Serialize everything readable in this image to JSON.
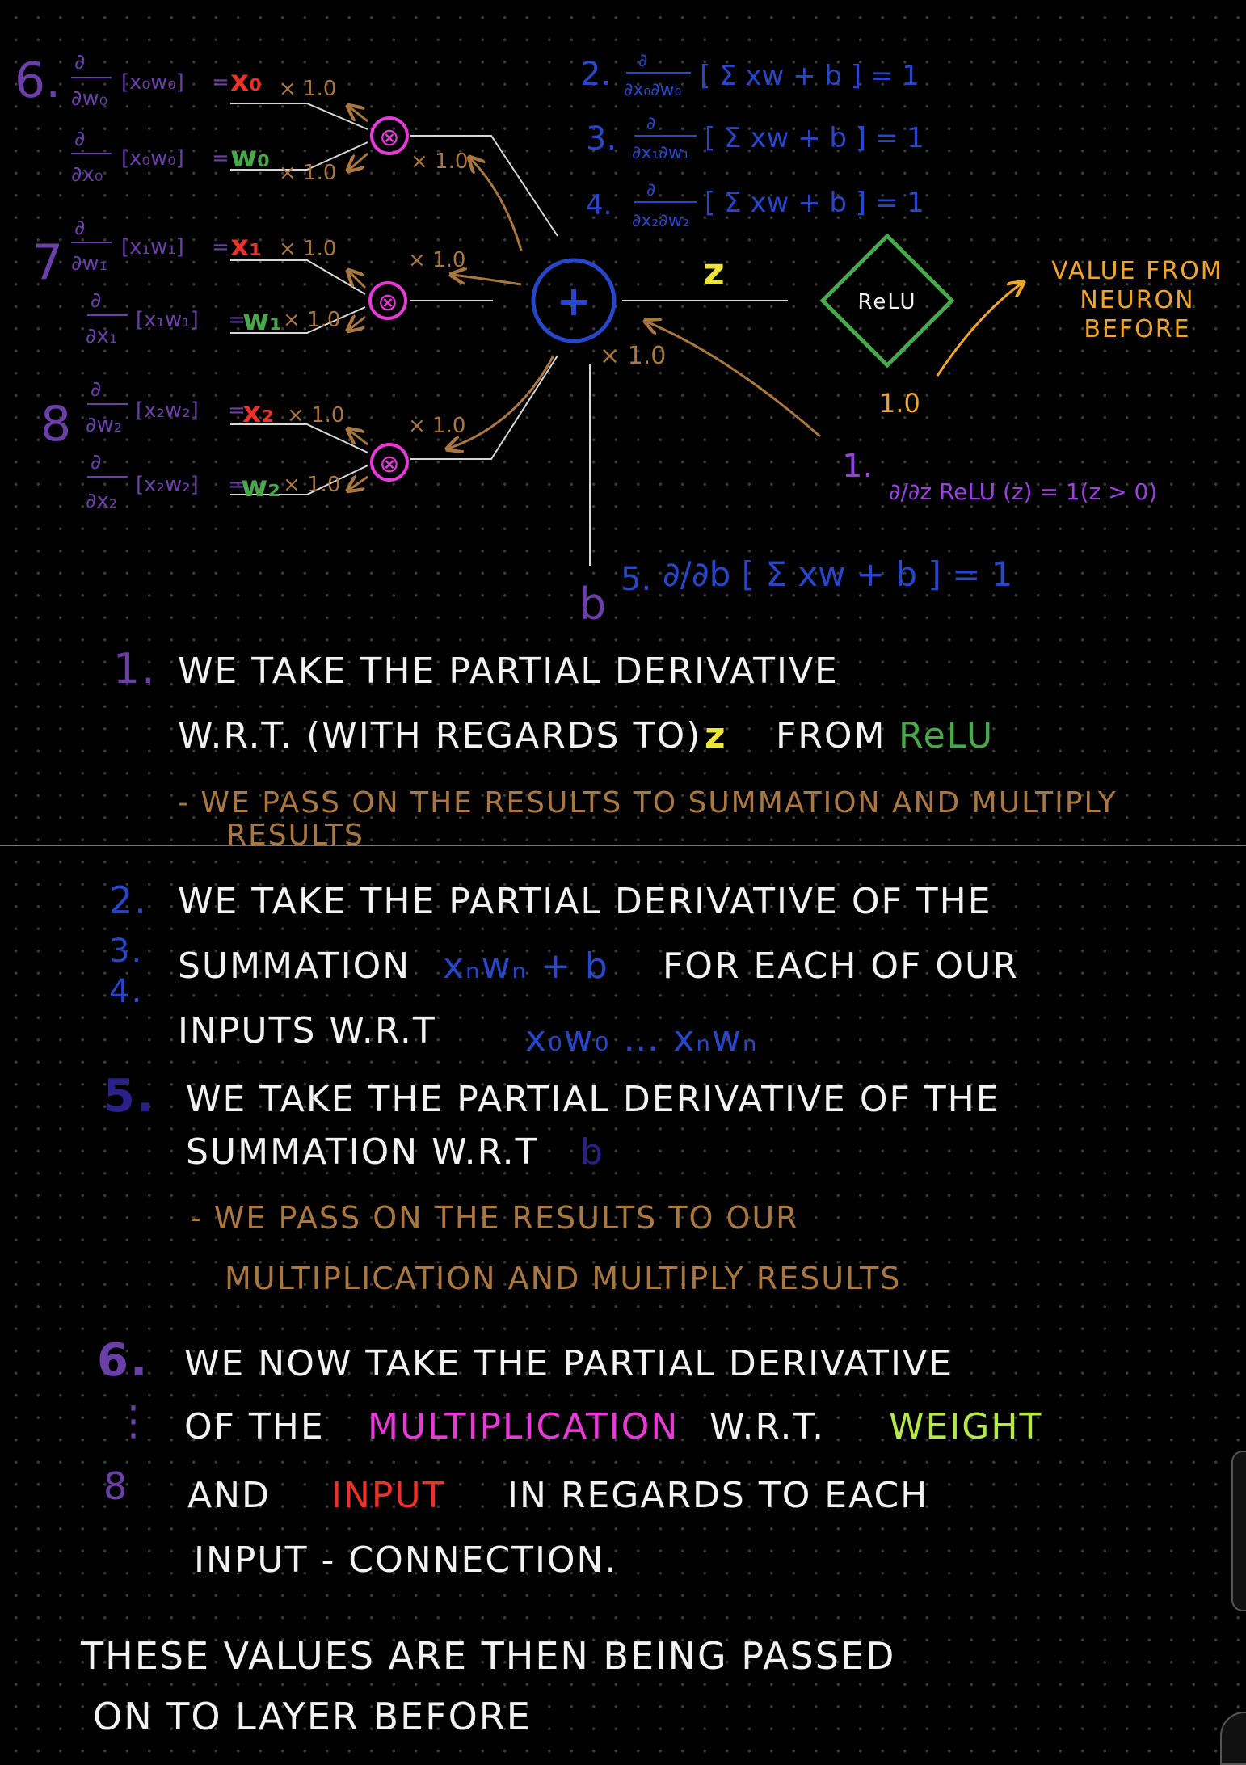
{
  "colors": {
    "purple": "#6b3fa8",
    "blue": "#2846c8",
    "pink": "#e83ad6",
    "red": "#e8322a",
    "green": "#48a84a",
    "yellow": "#ece63a",
    "brown": "#a9773f",
    "orange": "#f0a52a",
    "white": "#f2f2f2",
    "lime": "#b6e84a",
    "line": "#d8d8d8"
  },
  "diagram": {
    "left_eqs": [
      {
        "num": "6.",
        "d": "∂",
        "wrt": "∂w₀",
        "bracket": "[x₀w₀]",
        "eq": "=",
        "result": "x₀",
        "result_color": "red",
        "times": "× 1.0"
      },
      {
        "num": "",
        "d": "∂",
        "wrt": "∂x₀",
        "bracket": "[x₀w₀]",
        "eq": "=",
        "result": "w₀",
        "result_color": "green",
        "times": "× 1.0"
      },
      {
        "num": "7",
        "d": "∂",
        "wrt": "∂w₁",
        "bracket": "[x₁w₁]",
        "eq": "=",
        "result": "x₁",
        "result_color": "red",
        "times": "× 1.0"
      },
      {
        "num": "",
        "d": "∂",
        "wrt": "∂x₁",
        "bracket": "[x₁w₁]",
        "eq": "=",
        "result": "w₁",
        "result_color": "green",
        "times": "× 1.0"
      },
      {
        "num": "8",
        "d": "∂",
        "wrt": "∂w₂",
        "bracket": "[x₂w₂]",
        "eq": "=",
        "result": "x₂",
        "result_color": "red",
        "times": "× 1.0"
      },
      {
        "num": "",
        "d": "∂",
        "wrt": "∂x₂",
        "bracket": "[x₂w₂]",
        "eq": "=",
        "result": "w₂",
        "result_color": "green",
        "times": "× 1.0"
      }
    ],
    "mult_nodes": [
      "⊗",
      "⊗",
      "⊗"
    ],
    "mult_out_labels": [
      "× 1.0",
      "× 1.0",
      "× 1.0"
    ],
    "sum_node": "+",
    "sum_out_label": "× 1.0",
    "z_label": "z",
    "relu_label": "ReLU",
    "relu_grad": "1.0",
    "prev_value": "Value from neuron before",
    "top_eqs": [
      {
        "num": "2.",
        "wrt": "∂x₀∂w₀",
        "body": "[ Σ xw + b ] = 1"
      },
      {
        "num": "3.",
        "wrt": "∂x₁∂w₁",
        "body": "[ Σ xw + b ] = 1"
      },
      {
        "num": "4.",
        "wrt": "∂x₂∂w₂",
        "body": "[ Σ xw + b ] = 1"
      }
    ],
    "relu_eq_num": "1.",
    "relu_eq": "∂/∂z ReLU (z) = 1(z > 0)",
    "bias": "b",
    "bias_eq_num": "5.",
    "bias_eq": "∂/∂b [ Σ xw + b ] = 1"
  },
  "notes": {
    "n1": {
      "num": "1.",
      "line1": "WE TAKE THE PARTIAL DERIVATIVE",
      "line2_a": "W.R.T. (WITH REGARDS TO)",
      "line2_z": "z",
      "line2_b": "FROM",
      "line2_relu": "ReLU",
      "sub1": "- WE PASS ON THE RESULTS TO SUMMATION AND MULTIPLY",
      "sub2": "RESULTS"
    },
    "n2": {
      "nums": [
        "2.",
        "3.",
        "4."
      ],
      "line1": "WE TAKE THE PARTIAL DERIVATIVE  OF THE",
      "line2_a": "SUMMATION",
      "line2_expr": "xₙwₙ + b",
      "line2_b": "FOR EACH  OF OUR",
      "line3_a": "INPUTS   W.R.T",
      "line3_expr": "x₀w₀ … xₙwₙ"
    },
    "n5": {
      "num": "5.",
      "line1": "WE TAKE THE PARTIAL DERIVATIVE OF THE",
      "line2_a": "SUMMATION W.R.T",
      "line2_b": "b",
      "sub1": "- WE PASS ON THE RESULTS TO OUR",
      "sub2": "MULTIPLICATION AND MULTIPLY RESULTS"
    },
    "n6": {
      "num": "6.",
      "dots": "⋮",
      "num_end": "8",
      "line1": "WE NOW TAKE THE PARTIAL DERIVATIVE",
      "line2_a": "OF THE",
      "line2_mult": "MULTIPLICATION",
      "line2_b": "W.R.T.",
      "line2_weight": "WEIGHT",
      "line3_a": "AND",
      "line3_input": "INPUT",
      "line3_b": "IN REGARDS TO EACH",
      "line4": "INPUT - CONNECTION."
    },
    "final1": "THESE VALUES ARE THEN BEING PASSED",
    "final2": "ON TO LAYER BEFORE"
  }
}
